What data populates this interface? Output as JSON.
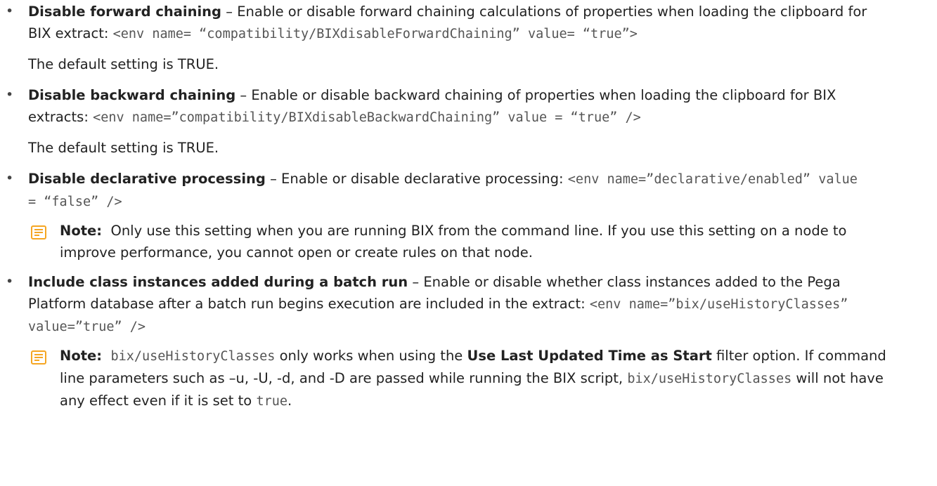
{
  "items": [
    {
      "term": "Disable forward chaining",
      "text": "Enable or disable forward chaining calculations of properties when loading the clipboard for BIX extract: ",
      "code": "<env name= “compatibility/BIXdisableForwardChaining” value= “true”>",
      "default": "The default setting is TRUE."
    },
    {
      "term": "Disable backward chaining",
      "text": "Enable or disable backward chaining of properties when loading the clipboard for BIX extracts: ",
      "code": "<env name=”compatibility/BIXdisableBackwardChaining” value = “true” />",
      "default": "The default setting is TRUE."
    },
    {
      "term": "Disable declarative processing",
      "text": "Enable or disable declarative processing: ",
      "code": "<env name=”declarative/enabled” value = “false” />",
      "note": {
        "label": "Note:",
        "text": "Only use this setting when you are running BIX from the command line. If you use this setting on a node to improve performance, you cannot open or create rules on that node."
      }
    },
    {
      "term": "Include class instances added during a batch run",
      "text": "Enable or disable whether class instances added to the Pega Platform database after a batch run begins execution are included in the extract: ",
      "code": "<env name=”bix/useHistoryClasses” value=”true” />",
      "note": {
        "label": "Note:",
        "code1": "bix/useHistoryClasses",
        "text1": " only works when using the ",
        "bold": "Use Last Updated Time as Start",
        "text2": " filter option. If command line parameters such as –u, -U, -d, and -D are passed while running the BIX script, ",
        "code2": "bix/useHistoryClasses",
        "text3": " will not have any effect even if it is set to ",
        "code3": "true",
        "text4": "."
      }
    }
  ],
  "separator": " – ",
  "bullet": "•",
  "colors": {
    "note_icon": "#f5a623",
    "code_text": "#555555",
    "body_text": "#222222"
  },
  "icons": {
    "note": "note-icon"
  }
}
